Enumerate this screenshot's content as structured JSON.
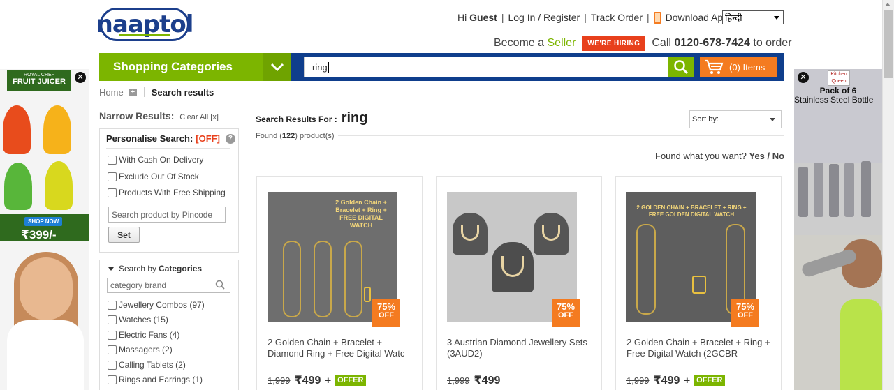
{
  "brand": {
    "logo_text": "naaptol"
  },
  "header": {
    "greeting_prefix": "Hi",
    "greeting_user": "Guest",
    "login_register": "Log In / Register",
    "track_order": "Track Order",
    "download_app": "Download App",
    "language": "हिन्दी",
    "become_a": "Become a",
    "seller": "Seller",
    "hiring_badge": "WE'RE HIRING",
    "call_prefix": "Call",
    "phone": "0120-678-7424",
    "call_suffix": "to order"
  },
  "nav": {
    "categories_label": "Shopping Categories",
    "search_value": "ring",
    "cart_label": "(0) Items"
  },
  "breadcrumb": {
    "home": "Home",
    "current": "Search results"
  },
  "sidebar": {
    "narrow_results": "Narrow Results:",
    "clear_all": "Clear All [x]",
    "personalise_label": "Personalise Search:",
    "personalise_state": "[OFF]",
    "help_icon": "?",
    "filters": [
      {
        "label": "With Cash On Delivery"
      },
      {
        "label": "Exclude Out Of Stock"
      },
      {
        "label": "Products With Free Shipping"
      }
    ],
    "pincode_placeholder": "Search product by Pincode",
    "set_button": "Set",
    "search_by": "Search by",
    "categories_word": "Categories",
    "category_placeholder": "category brand",
    "categories": [
      {
        "label": "Jewellery Combos (97)"
      },
      {
        "label": "Watches (15)"
      },
      {
        "label": "Electric Fans (4)"
      },
      {
        "label": "Massagers (2)"
      },
      {
        "label": "Calling Tablets (2)"
      },
      {
        "label": "Rings and Earrings (1)"
      }
    ]
  },
  "results": {
    "label": "Search Results For :",
    "query": "ring",
    "found_prefix": "Found (",
    "found_count": "122",
    "found_suffix": ") product(s)",
    "sort_label": "Sort by:",
    "feedback_question": "Found what you want?",
    "feedback_yes": "Yes",
    "feedback_sep": "/",
    "feedback_no": "No"
  },
  "products": [
    {
      "title": "2 Golden Chain + Bracelet + Diamond Ring + Free Digital Watc",
      "mrp": "1,999",
      "price": "₹499",
      "offer": "OFFER",
      "discount": "75%",
      "off": "OFF",
      "image_text": "2 Golden Chain + Bracelet + Ring + FREE DIGITAL WATCH"
    },
    {
      "title": "3 Austrian Diamond Jewellery Sets (3AUD2)",
      "mrp": "1,999",
      "price": "₹499",
      "offer": "",
      "discount": "75%",
      "off": "OFF",
      "image_text": ""
    },
    {
      "title": "2 Golden Chain + Bracelet + Ring + Free Digital Watch (2GCBR",
      "mrp": "1,999",
      "price": "₹499",
      "offer": "OFFER",
      "discount": "75%",
      "off": "OFF",
      "image_text": "2 GOLDEN CHAIN + BRACELET + RING + FREE GOLDEN DIGITAL WATCH"
    }
  ],
  "ads": {
    "left": {
      "brand": "ROYAL CHEF",
      "title": "FRUIT JUICER",
      "shop_now": "SHOP NOW",
      "price": "₹399/-"
    },
    "right": {
      "brand": "Kitchen Queen",
      "title_line1": "Pack of 6",
      "title_line2": "Stainless Steel Bottle"
    }
  },
  "colors": {
    "brand_blue": "#1c3f8c",
    "green": "#7cb500",
    "orange": "#f47b20",
    "hiring_red": "#e8401c"
  },
  "icons": {
    "search": "search-icon",
    "cart": "cart-icon",
    "chevron": "chevron-down-icon",
    "phone": "phone-icon",
    "close": "close-icon"
  }
}
